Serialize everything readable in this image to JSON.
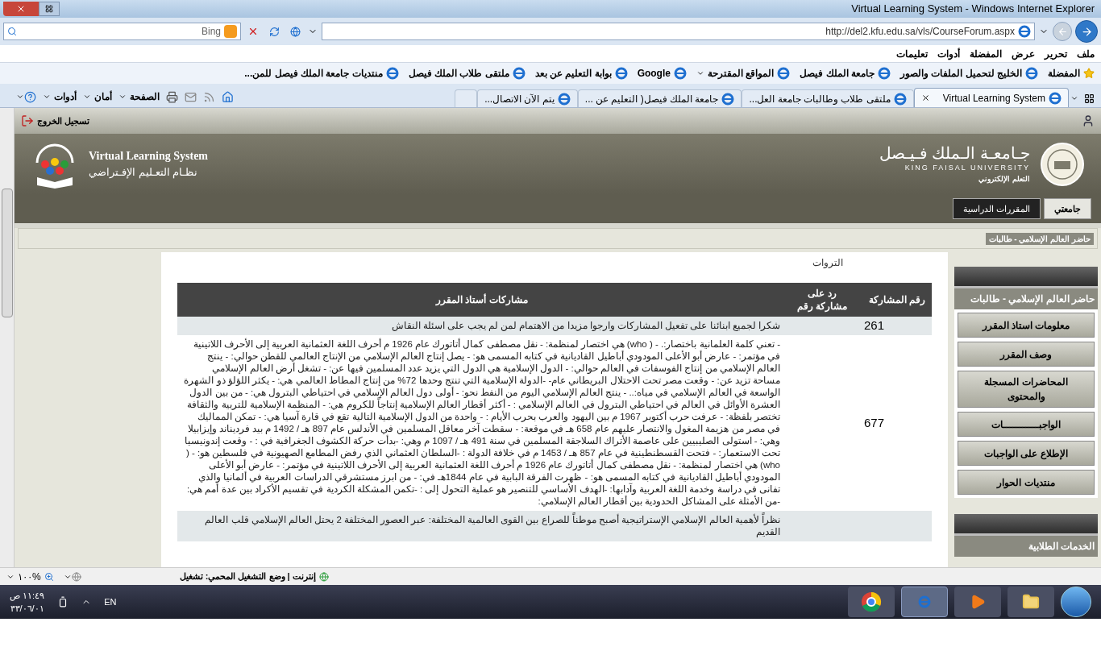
{
  "browser": {
    "title": "Virtual Learning System - Windows Internet Explorer",
    "address": "http://del2.kfu.edu.sa/vls/CourseForum.aspx",
    "search_placeholder": "Bing",
    "menu": [
      "ملف",
      "تحرير",
      "عرض",
      "المفضلة",
      "أدوات",
      "تعليمات"
    ],
    "favorites_label": "المفضلة",
    "favorites": [
      {
        "label": "الخليج لتحميل الملفات والصور",
        "dropdown": false
      },
      {
        "label": "جامعة الملك فيصل",
        "dropdown": false
      },
      {
        "label": "المواقع المقترحة",
        "dropdown": true
      },
      {
        "label": "Google",
        "dropdown": false
      },
      {
        "label": "بوابة التعليم عن بعد",
        "dropdown": false
      },
      {
        "label": "ملتقى طلاب الملك فيصل",
        "dropdown": false
      },
      {
        "label": "منتديات جامعة الملك فيصل للمن...",
        "dropdown": false
      }
    ],
    "tabs": [
      {
        "label": "Virtual Learning System",
        "selected": true
      },
      {
        "label": "ملتقى طلاب وطالبات جامعة العل...",
        "selected": false
      },
      {
        "label": "جامعة الملك فيصل( التعليم عن ...",
        "selected": false
      },
      {
        "label": "يتم الآن الاتصال...",
        "selected": false
      }
    ],
    "commands": [
      "الصفحة",
      "أمان",
      "أدوات"
    ]
  },
  "page": {
    "logout": "تسجيل الخروج",
    "brand": {
      "title": "Virtual Learning System",
      "subtitle": "نظـام التعـليم الإفـتراضي"
    },
    "university": {
      "name": "جـامعـة الـملك فـيـصل",
      "name_en": "KING FAISAL UNIVERSITY",
      "unit": "التعلم الإلكتروني"
    },
    "nav": [
      {
        "label": "جامعتي",
        "selected": true
      },
      {
        "label": "المقررات الدراسية",
        "selected": false
      }
    ],
    "breadcrumb": "حاضر العالم الإسلامي - طالبات",
    "partial_text": "التروات",
    "table": {
      "columns": [
        "رقم المشاركة",
        "رد على مشاركة رقم",
        "مشاركات أستاذ المقرر"
      ],
      "rows": [
        {
          "number": "261",
          "text": "شكرا لجميع ابنائنا على تفعيل المشاركات وارجوا مزيدا من الاهتمام لمن لم يجب على اسئلة النقاش"
        },
        {
          "number": "677",
          "text": "- تعني كلمة العلمانية باختصار:. - ( who) هي اختصار لمنظمة: - نقل مصطفى كمال أتاتورك عام 1926 م أحرف اللغة العثمانية العربية إلى الأحرف اللاتينية في مؤتمر: - عارض أبو الأعلى المودودي أباطيل القاديانية في كتابه المسمى هو: - يصل إنتاج العالم الإسلامي من الإنتاج العالمي للقطن حوالي: - ينتج العالم الإسلامي من إنتاج الفوسفات في العالم حوالي: - الدول الإسلامية هي الدول التي يزيد عدد المسلمين فيها عن: - تشغل أرض العالم الإسلامي مساحة تزيد عن: - وقعت مصر تحت الاحتلال البريطاني عام- -الدولة الإسلامية التي تنتج وحدها 72% من إنتاج المطاط العالمي هي: - يكثر اللؤلؤ ذو الشهرة الواسعة في العالم الإسلامي في مياه:.. - ينتج العالم الإسلامي اليوم من النفط نحو: - أولى دول العالم الإسلامي في احتياطي البترول هي: - من بين الدول العشرة الأوائل في العالم في احتياطي البترول في العالم الإسلامي : - أكثر أقطار العالم الإسلامية إنتاجاً للكروم هي: - المنظمة الإسلامية للتربية والثقافة تختصر بلفظة: - عرفت حرب أكتوبر 1967 م بين اليهود والعرب بحرب الأيام : - واحدة من الدول الإسلامية التالية تقع في قارة آسيا هي: - تمكن المماليك في مصر من هزيمة المغول والانتصار عليهم عام 658 هـ في موقعة: - سقطت آخر معاقل المسلمين في الأندلس عام 897 هـ / 1492 م بيد فرديناند وإيزابيلا وهي: - استولى الصليبيين على عاصمة الأتراك السلاجقة المسلمين في سنة 491 هـ / 1097 م وهي: -بدأت حركة الكشوف الجغرافية في : - وقعت إندونيسيا تحت الاستعمار: - فتحت القسطنطينية في عام 857 هـ / 1453 م في خلافة الدولة : -السلطان العثماني الذي رفض المطامع الصهيونية في فلسطين هو: - ( who) هي اختصار لمنظمة: - نقل مصطفى كمال أتاتورك عام 1926 م أحرف اللغة العثمانية العربية إلى الأحرف اللاتينية في مؤتمر: - عارض أبو الأعلى المودودي أباطيل القاديانية في كتابه المسمى هو: - ظهرت الفرقة البابية في عام 1844هـ في: - من ابرز مستشرقي الدراسات العربية في ألمانيا والذي تفانى في دراسة وخدمة اللغة العربية وآدابها: -الهدف الأساسي للتنصير هو عملية التحول إلى : -تكمن المشكلة الكردية في تقسيم الأكراد بين عدة أمم هي: -من الأمثلة على المشاكل الحدودية بين أقطار العالم الإسلامي:"
        },
        {
          "text": "نظراً لأهمية العالم الإسلامي الإستراتيجية أصبح موطناً للصراع بين القوى العالمية المختلفة: عبر العصور المختلفة 2 يحتل العالم الإسلامي قلب العالم القديم"
        }
      ]
    },
    "sidebar": {
      "title": "حاضر العالم الإسلامي - طالبات",
      "items": [
        "معلومات استاذ المقرر",
        "وصف المقرر",
        "المحاضرات المسجلة والمحتوى",
        "الواجبـــــــــــات",
        "الإطلاع على الواجبات",
        "منتديات الحوار"
      ],
      "section_title": "الخدمات الطلابية"
    }
  },
  "status_bar": {
    "zone": "إنترنت | وضع التشغيل المحمي: تشغيل",
    "zoom": "١٠٠%"
  },
  "taskbar": {
    "language": "EN",
    "time": "١١:٤٩ ص",
    "date": "٣٣/٠٦/٠١"
  }
}
